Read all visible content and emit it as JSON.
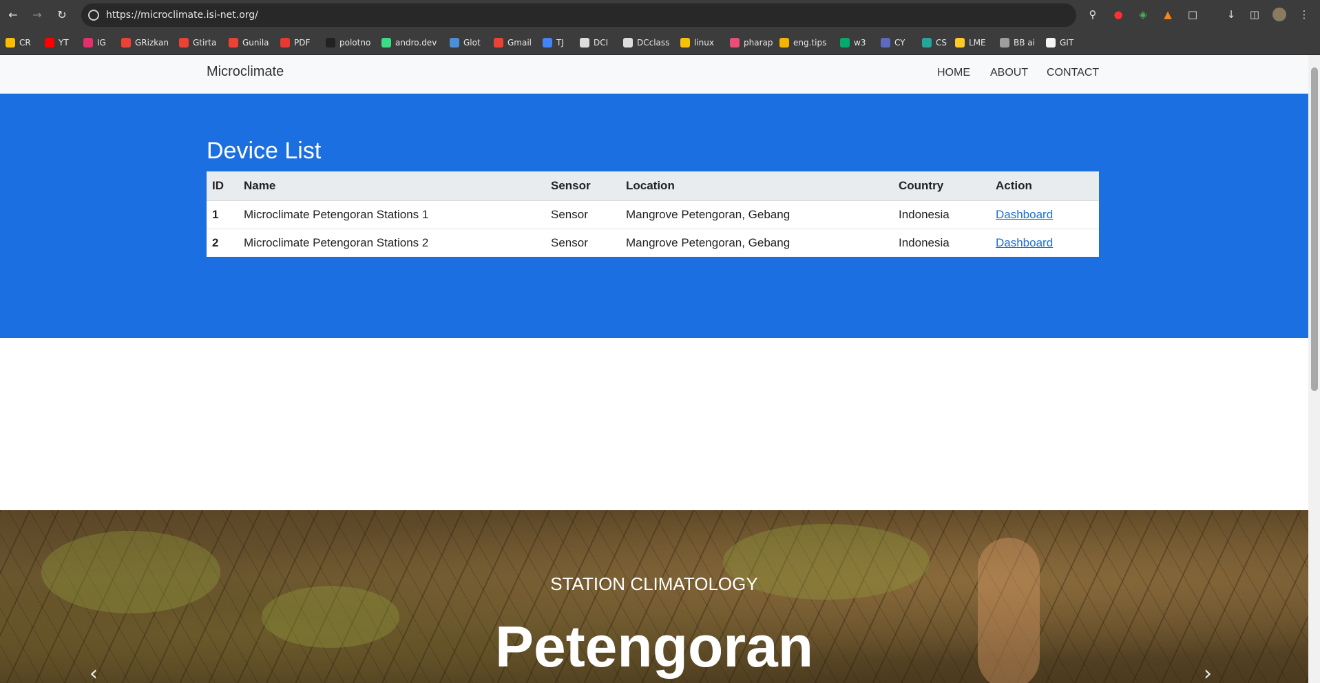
{
  "browser": {
    "url": "https://microclimate.isi-net.org/",
    "bookmarks": [
      {
        "label": "CR",
        "color": "#fbbc04"
      },
      {
        "label": "YT",
        "color": "#ff0000"
      },
      {
        "label": "IG",
        "color": "#e1306c"
      },
      {
        "label": "GRizkan",
        "color": "#ea4335"
      },
      {
        "label": "Gtirta",
        "color": "#ea4335"
      },
      {
        "label": "Gunila",
        "color": "#ea4335"
      },
      {
        "label": "PDF",
        "color": "#e53935"
      },
      {
        "label": "polotno",
        "color": "#222222"
      },
      {
        "label": "andro.dev",
        "color": "#3ddc84"
      },
      {
        "label": "Glot",
        "color": "#4a90d9"
      },
      {
        "label": "Gmail",
        "color": "#ea4335"
      },
      {
        "label": "TJ",
        "color": "#4285f4"
      },
      {
        "label": "DCI",
        "color": "#dddddd"
      },
      {
        "label": "DCclass",
        "color": "#dddddd"
      },
      {
        "label": "linux",
        "color": "#f4c20d"
      },
      {
        "label": "pharap",
        "color": "#e94e77"
      },
      {
        "label": "eng.tips",
        "color": "#f4b400"
      },
      {
        "label": "w3",
        "color": "#04aa6d"
      },
      {
        "label": "CY",
        "color": "#5c6bc0"
      },
      {
        "label": "CS",
        "color": "#26a69a"
      },
      {
        "label": "LME",
        "color": "#ffca28"
      },
      {
        "label": "BB ai",
        "color": "#9e9e9e"
      },
      {
        "label": "GIT",
        "color": "#f5f5f5"
      }
    ]
  },
  "navbar": {
    "brand": "Microclimate",
    "links": [
      "HOME",
      "ABOUT",
      "CONTACT"
    ]
  },
  "devices": {
    "title": "Device List",
    "columns": [
      "ID",
      "Name",
      "Sensor",
      "Location",
      "Country",
      "Action"
    ],
    "rows": [
      {
        "id": "1",
        "name": "Microclimate Petengoran Stations 1",
        "sensor": "Sensor",
        "location": "Mangrove Petengoran, Gebang",
        "country": "Indonesia",
        "action": "Dashboard"
      },
      {
        "id": "2",
        "name": "Microclimate Petengoran Stations 2",
        "sensor": "Sensor",
        "location": "Mangrove Petengoran, Gebang",
        "country": "Indonesia",
        "action": "Dashboard"
      }
    ]
  },
  "banner": {
    "subtitle": "STATION CLIMATOLOGY",
    "title": "Petengoran"
  },
  "colors": {
    "hero_blue": "#1c6fe0",
    "link": "#1a6fd6",
    "navbar_bg": "#f8f9fa"
  }
}
